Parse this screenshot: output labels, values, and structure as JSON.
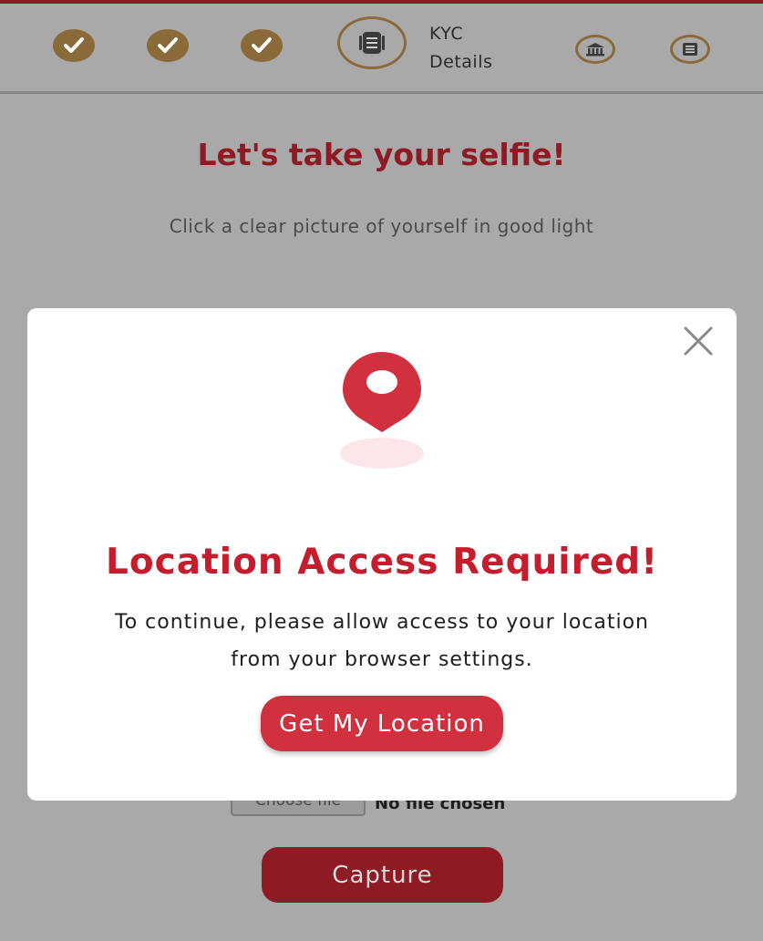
{
  "colors": {
    "brand": "#8e1b24",
    "accent_red": "#c41e2e",
    "button_red": "#d1303f",
    "step_gold": "#8b6a3a",
    "overlay_gray": "#a9a9a9"
  },
  "stepper": {
    "completed_steps": [
      {
        "icon": "check-icon"
      },
      {
        "icon": "check-icon"
      },
      {
        "icon": "check-icon"
      }
    ],
    "current_step": {
      "icon": "document-icon",
      "label_line1": "KYC",
      "label_line2": "Details"
    },
    "future_steps": [
      {
        "icon": "bank-icon"
      },
      {
        "icon": "list-icon"
      }
    ]
  },
  "page": {
    "title": "Let's take your selfie!",
    "subtitle": "Click a clear picture of yourself in good light",
    "file_button_label": "Choose file",
    "file_status": "No file chosen",
    "capture_label": "Capture"
  },
  "modal": {
    "close_icon": "close-icon",
    "pin_icon": "location-pin-icon",
    "title": "Location Access Required!",
    "text": "To continue, please allow access to your location from your browser settings.",
    "button_label": "Get My Location"
  }
}
